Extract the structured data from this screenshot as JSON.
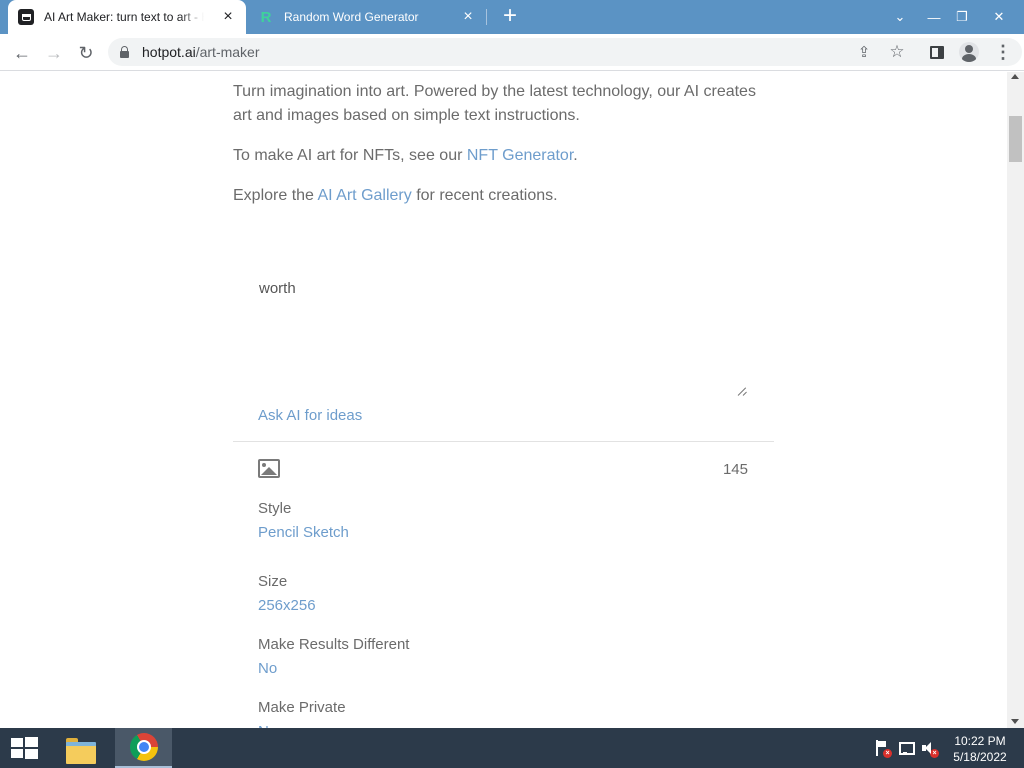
{
  "browser": {
    "tabs": [
      {
        "title": "AI Art Maker: turn text to art - Hotpot.ai",
        "favicon": "hotpot-icon",
        "active": true
      },
      {
        "title": "Random Word Generator",
        "favicon": "letter-r-icon",
        "favicon_text": "R",
        "active": false
      }
    ],
    "new_tab_label": "+",
    "window_controls": {
      "dropdown": "⌄",
      "minimize": "—",
      "restore": "❐",
      "close": "✕"
    },
    "address": {
      "host": "hotpot.ai",
      "path": "/art-maker"
    },
    "nav": {
      "back": "←",
      "forward": "→",
      "reload": "↻"
    },
    "omnibox_icons": {
      "share": "⇪",
      "bookmark": "☆"
    },
    "menu": "⋮",
    "colors": {
      "tabstrip": "#5b93c4",
      "link": "#6e9dcc"
    }
  },
  "page": {
    "intro": "Turn imagination into art. Powered by the latest technology, our AI creates art and images based on simple text instructions.",
    "nft_prefix": "To make AI art for NFTs, see our ",
    "nft_link": "NFT Generator",
    "nft_suffix": ".",
    "gallery_prefix": "Explore the ",
    "gallery_link": "AI Art Gallery",
    "gallery_suffix": " for recent creations.",
    "prompt_value": "worth",
    "ask_ai": "Ask AI for ideas",
    "char_count": "145",
    "options": {
      "style": {
        "label": "Style",
        "value": "Pencil Sketch"
      },
      "size": {
        "label": "Size",
        "value": "256x256"
      },
      "different": {
        "label": "Make Results Different",
        "value": "No"
      },
      "private": {
        "label": "Make Private",
        "value": "No"
      }
    }
  },
  "taskbar": {
    "apps": [
      "file-explorer",
      "google-chrome"
    ],
    "clock_time": "10:22 PM",
    "clock_date": "5/18/2022"
  }
}
